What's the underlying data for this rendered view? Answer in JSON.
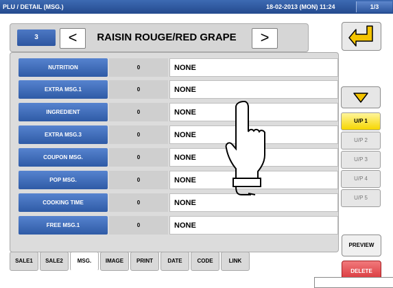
{
  "status": {
    "title": "PLU / DETAIL (MSG.)",
    "datetime": "18-02-2013 (MON) 11:24",
    "page_indicator": "1/3"
  },
  "plu": {
    "number": "3",
    "name": "RAISIN ROUGE/RED GRAPE",
    "prev_label": "<",
    "next_label": ">"
  },
  "rows": [
    {
      "label": "NUTRITION",
      "count": "0",
      "value": "NONE"
    },
    {
      "label": "EXTRA MSG.1",
      "count": "0",
      "value": "NONE"
    },
    {
      "label": "INGREDIENT",
      "count": "0",
      "value": "NONE"
    },
    {
      "label": "EXTRA MSG.3",
      "count": "0",
      "value": "NONE"
    },
    {
      "label": "COUPON MSG.",
      "count": "0",
      "value": "NONE"
    },
    {
      "label": "POP MSG.",
      "count": "0",
      "value": "NONE"
    },
    {
      "label": "COOKING TIME",
      "count": "0",
      "value": "NONE"
    },
    {
      "label": "FREE MSG.1",
      "count": "0",
      "value": "NONE"
    }
  ],
  "tabs": [
    {
      "label": "SALE1"
    },
    {
      "label": "SALE2"
    },
    {
      "label": "MSG."
    },
    {
      "label": "IMAGE"
    },
    {
      "label": "PRINT"
    },
    {
      "label": "DATE"
    },
    {
      "label": "CODE"
    },
    {
      "label": "LINK"
    }
  ],
  "right_panel": {
    "pages": [
      "U/P 1",
      "U/P 2",
      "U/P 3",
      "U/P 4",
      "U/P 5"
    ],
    "preview_label": "PREVIEW",
    "delete_label": "DELETE"
  },
  "colors": {
    "header_blue": "#244a8e",
    "label_blue": "#2f5ba6",
    "active_yellow": "#f6d600",
    "delete_red": "#d62f34"
  },
  "icons": {
    "back": "return-arrow-icon",
    "down": "down-triangle-icon",
    "hand": "pointing-hand-icon"
  }
}
